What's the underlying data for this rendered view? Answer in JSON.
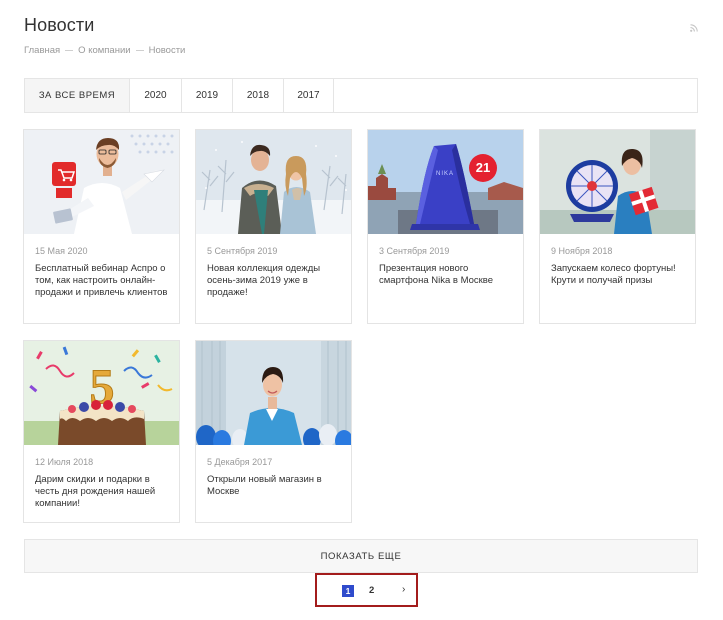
{
  "page": {
    "title": "Новости"
  },
  "breadcrumb": [
    "Главная",
    "О компании",
    "Новости"
  ],
  "filters": [
    "ЗА ВСЕ ВРЕМЯ",
    "2020",
    "2019",
    "2018",
    "2017"
  ],
  "news": [
    {
      "date": "15 Мая 2020",
      "title": "Бесплатный вебинар Аспро о том, как настроить онлайн-продажи и привлечь клиентов"
    },
    {
      "date": "5 Сентября 2019",
      "title": "Новая коллекция одежды осень-зима 2019 уже в продаже!"
    },
    {
      "date": "3 Сентября 2019",
      "title": "Презентация нового смартфона Nika в Москве"
    },
    {
      "date": "9 Ноября 2018",
      "title": "Запускаем колесо фортуны! Крути и получай призы"
    },
    {
      "date": "12 Июля 2018",
      "title": "Дарим скидки и подарки в честь дня рождения нашей компании!"
    },
    {
      "date": "5 Декабря 2017",
      "title": "Открыли новый магазин в Москве"
    }
  ],
  "image_text": {
    "badge_21": "21",
    "nika": "NIKA",
    "five": "5"
  },
  "show_more": "ПОКАЗАТЬ ЕЩЕ",
  "pagination": {
    "current": "1",
    "page2": "2",
    "next": "›"
  },
  "colors": {
    "accent": "#2f4bcc",
    "highlight_border": "#a31c1c"
  },
  "icons": [
    "rss-icon",
    "chevron-right-icon"
  ]
}
